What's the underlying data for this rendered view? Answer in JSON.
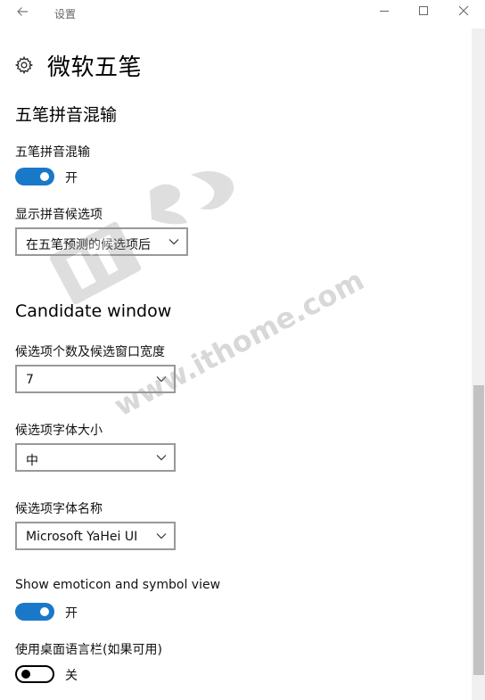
{
  "window": {
    "title": "设置"
  },
  "header": {
    "title": "微软五笔",
    "icon": "gear-icon"
  },
  "section1": {
    "title": "五笔拼音混输",
    "mixed_input": {
      "label": "五笔拼音混输",
      "state": "开",
      "on": true
    },
    "pinyin_candidates": {
      "label": "显示拼音候选项",
      "value": "在五笔预测的候选项后"
    }
  },
  "section2": {
    "title": "Candidate window",
    "count_width": {
      "label": "候选项个数及候选窗口宽度",
      "value": "7"
    },
    "font_size": {
      "label": "候选项字体大小",
      "value": "中"
    },
    "font_name": {
      "label": "候选项字体名称",
      "value": "Microsoft YaHei UI"
    },
    "emoticon": {
      "label": "Show emoticon and symbol view",
      "state": "开",
      "on": true
    },
    "language_bar": {
      "label": "使用桌面语言栏(如果可用)",
      "state": "关",
      "on": false
    }
  },
  "watermark": {
    "brand": "IT之家",
    "url": "www.ithome.com"
  },
  "colors": {
    "accent": "#1a78c9",
    "border": "#999999",
    "watermark": "#c8c8c8"
  }
}
